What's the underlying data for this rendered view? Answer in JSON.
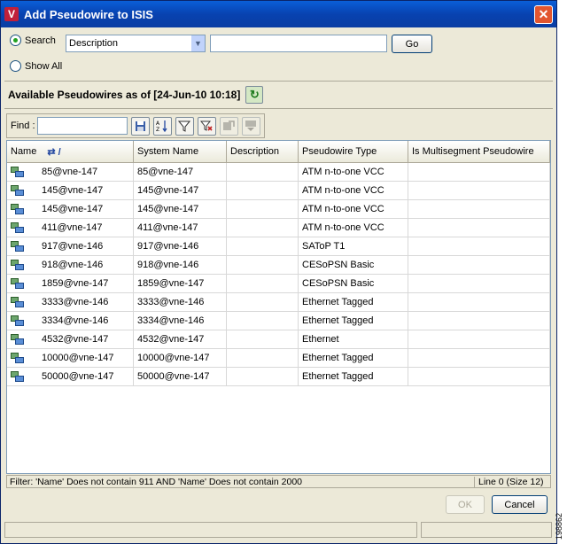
{
  "window": {
    "title": "Add Pseudowire to ISIS",
    "app_icon_letter": "V",
    "close_label": "✕"
  },
  "search": {
    "search_label": "Search",
    "field_value": "Description",
    "text_value": "",
    "go_label": "Go",
    "show_all_label": "Show All",
    "selected": "Search"
  },
  "available": {
    "heading": "Available Pseudowires as of [24-Jun-10 10:18]",
    "refresh_icon": "refresh-icon"
  },
  "toolbar": {
    "find_label": "Find :",
    "find_value": "",
    "buttons": [
      "save-icon",
      "sort-az-icon",
      "filter-icon",
      "clear-filter-icon",
      "export-icon",
      "import-icon"
    ]
  },
  "table": {
    "headers": [
      "Name",
      "System Name",
      "Description",
      "Pseudowire Type",
      "Is Multisegment Pseudowire"
    ],
    "sort_indicator": "⇄ /",
    "rows": [
      {
        "name": "85@vne-147",
        "system": "85@vne-147",
        "desc": "",
        "type": "ATM n-to-one VCC",
        "multi": ""
      },
      {
        "name": "145@vne-147",
        "system": "145@vne-147",
        "desc": "",
        "type": "ATM n-to-one VCC",
        "multi": ""
      },
      {
        "name": "145@vne-147",
        "system": "145@vne-147",
        "desc": "",
        "type": "ATM n-to-one VCC",
        "multi": ""
      },
      {
        "name": "411@vne-147",
        "system": "411@vne-147",
        "desc": "",
        "type": "ATM n-to-one VCC",
        "multi": ""
      },
      {
        "name": "917@vne-146",
        "system": "917@vne-146",
        "desc": "",
        "type": "SAToP T1",
        "multi": ""
      },
      {
        "name": "918@vne-146",
        "system": "918@vne-146",
        "desc": "",
        "type": "CESoPSN Basic",
        "multi": ""
      },
      {
        "name": "1859@vne-147",
        "system": "1859@vne-147",
        "desc": "",
        "type": "CESoPSN Basic",
        "multi": ""
      },
      {
        "name": "3333@vne-146",
        "system": "3333@vne-146",
        "desc": "",
        "type": "Ethernet Tagged",
        "multi": ""
      },
      {
        "name": "3334@vne-146",
        "system": "3334@vne-146",
        "desc": "",
        "type": "Ethernet Tagged",
        "multi": ""
      },
      {
        "name": "4532@vne-147",
        "system": "4532@vne-147",
        "desc": "",
        "type": "Ethernet",
        "multi": ""
      },
      {
        "name": "10000@vne-147",
        "system": "10000@vne-147",
        "desc": "",
        "type": "Ethernet Tagged",
        "multi": ""
      },
      {
        "name": "50000@vne-147",
        "system": "50000@vne-147",
        "desc": "",
        "type": "Ethernet Tagged",
        "multi": ""
      }
    ]
  },
  "status": {
    "filter_text": "Filter: 'Name' Does not contain 911 AND 'Name' Does not contain 2000",
    "line_text": "Line 0 (Size 12)"
  },
  "buttons": {
    "ok_label": "OK",
    "cancel_label": "Cancel"
  },
  "side_id": "198862",
  "colors": {
    "titlebar": "#0a4fc4",
    "window_bg": "#ece9d8",
    "border": "#7f9db9"
  }
}
